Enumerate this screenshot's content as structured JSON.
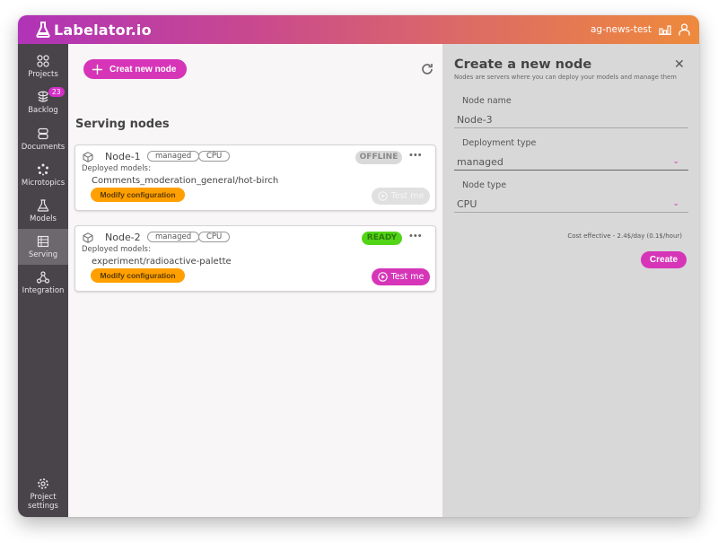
{
  "app": {
    "brand": "Labelator.io",
    "project_name": "ag-news-test"
  },
  "colors": {
    "accent": "#d635b8",
    "warning": "#ffa000",
    "ready": "#52d417",
    "offline": "#d9d9d9",
    "sidebar_bg": "#48444a"
  },
  "sidebar": {
    "items": [
      {
        "label": "Projects",
        "icon": "projects-grid-icon"
      },
      {
        "label": "Backlog",
        "icon": "backlog-stack-icon",
        "badge": "23"
      },
      {
        "label": "Documents",
        "icon": "documents-icon"
      },
      {
        "label": "Microtopics",
        "icon": "microtopics-icon"
      },
      {
        "label": "Models",
        "icon": "flask-icon"
      },
      {
        "label": "Serving",
        "icon": "serving-icon",
        "active": true
      },
      {
        "label": "Integration",
        "icon": "integration-icon"
      }
    ],
    "footer": {
      "label_line1": "Project",
      "label_line2": "settings",
      "icon": "gear-icon"
    }
  },
  "main": {
    "create_button": "Creat new node",
    "section_title": "Serving nodes",
    "deployed_label": "Deployed models:",
    "modify_label": "Modify configuration",
    "test_label": "Test me",
    "nodes": [
      {
        "name": "Node-1",
        "tags": [
          "managed",
          "CPU"
        ],
        "status": "OFFLINE",
        "model": "Comments_moderation_general/hot-birch",
        "test_enabled": false
      },
      {
        "name": "Node-2",
        "tags": [
          "managed",
          "CPU"
        ],
        "status": "READY",
        "model": "experiment/radioactive-palette",
        "test_enabled": true
      }
    ]
  },
  "panel": {
    "title": "Create a new node",
    "subtitle": "Nodes are servers where you can deploy your models and manage them",
    "fields": {
      "node_name": {
        "label": "Node name",
        "value": "Node-3"
      },
      "deployment_type": {
        "label": "Deployment type",
        "value": "managed"
      },
      "node_type": {
        "label": "Node type",
        "value": "CPU"
      }
    },
    "cost_note": "Cost effective - 2.4$/day (0.1$/hour)",
    "create_label": "Create"
  }
}
